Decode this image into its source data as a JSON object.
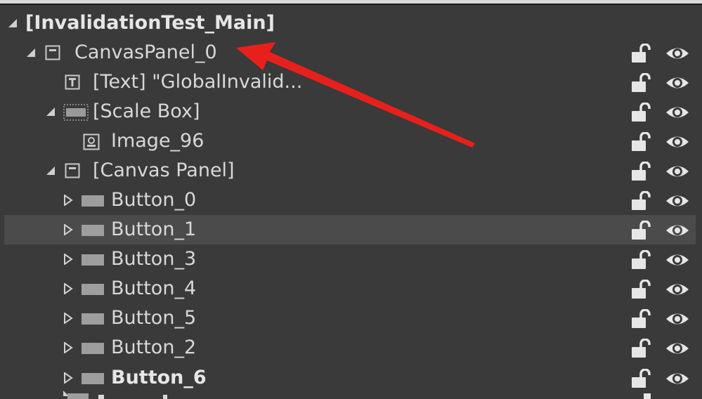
{
  "hierarchy": {
    "root": "[InvalidationTest_Main]",
    "items": [
      {
        "label": "CanvasPanel_0",
        "icon": "canvas-panel-icon",
        "expanded": true
      },
      {
        "label": "[Text] \"GlobalInvalid...",
        "icon": "text-widget-icon"
      },
      {
        "label": "[Scale Box]",
        "icon": "scale-box-icon",
        "expanded": true
      },
      {
        "label": "Image_96",
        "icon": "image-widget-icon"
      },
      {
        "label": "[Canvas Panel]",
        "icon": "canvas-panel-icon",
        "expanded": true
      },
      {
        "label": "Button_0",
        "icon": "button-widget-icon",
        "expanded": false
      },
      {
        "label": "Button_1",
        "icon": "button-widget-icon",
        "expanded": false,
        "selected": true
      },
      {
        "label": "Button_3",
        "icon": "button-widget-icon",
        "expanded": false
      },
      {
        "label": "Button_4",
        "icon": "button-widget-icon",
        "expanded": false
      },
      {
        "label": "Button_5",
        "icon": "button-widget-icon",
        "expanded": false
      },
      {
        "label": "Button_2",
        "icon": "button-widget-icon",
        "expanded": false
      },
      {
        "label": "Button_6",
        "icon": "button-widget-icon",
        "expanded": false,
        "bold": true
      }
    ],
    "row_actions": {
      "lock_icon": "unlocked-padlock-icon",
      "visibility_icon": "eye-icon"
    }
  },
  "annotation": {
    "icon": "red-arrow-icon",
    "color": "#e8201c"
  },
  "colors": {
    "background": "#3a3a3a",
    "selected_row": "#4b4b4b",
    "text": "#d8d8d8"
  }
}
